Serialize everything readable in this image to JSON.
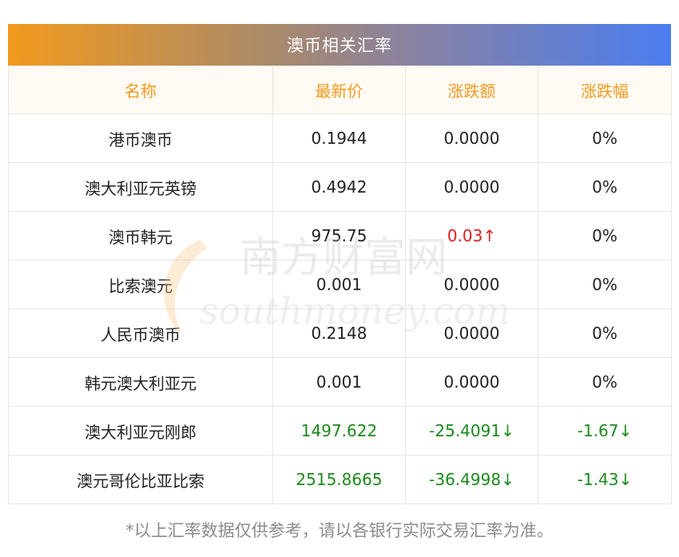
{
  "title": "澳币相关汇率",
  "columns": [
    "名称",
    "最新价",
    "涨跌额",
    "涨跌幅"
  ],
  "rows": [
    {
      "name": "港币澳币",
      "price": "0.1944",
      "change": "0.0000",
      "pct": "0%",
      "trend": "flat"
    },
    {
      "name": "澳大利亚元英镑",
      "price": "0.4942",
      "change": "0.0000",
      "pct": "0%",
      "trend": "flat"
    },
    {
      "name": "澳币韩元",
      "price": "975.75",
      "change": "0.03↑",
      "pct": "0%",
      "trend": "up"
    },
    {
      "name": "比索澳元",
      "price": "0.001",
      "change": "0.0000",
      "pct": "0%",
      "trend": "flat"
    },
    {
      "name": "人民币澳币",
      "price": "0.2148",
      "change": "0.0000",
      "pct": "0%",
      "trend": "flat"
    },
    {
      "name": "韩元澳大利亚元",
      "price": "0.001",
      "change": "0.0000",
      "pct": "0%",
      "trend": "flat"
    },
    {
      "name": "澳大利亚元刚郎",
      "price": "1497.622",
      "change": "-25.4091↓",
      "pct": "-1.67↓",
      "trend": "down"
    },
    {
      "name": "澳元哥伦比亚比索",
      "price": "2515.8665",
      "change": "-36.4998↓",
      "pct": "-1.43↓",
      "trend": "down"
    }
  ],
  "watermark": {
    "cn": "南方财富网",
    "en": "southmoney.com"
  },
  "note": "*以上汇率数据仅供参考，请以各银行实际交易汇率为准。",
  "colors": {
    "up": "#e02020",
    "down": "#1a8a1a",
    "header": "#f39a1e"
  }
}
